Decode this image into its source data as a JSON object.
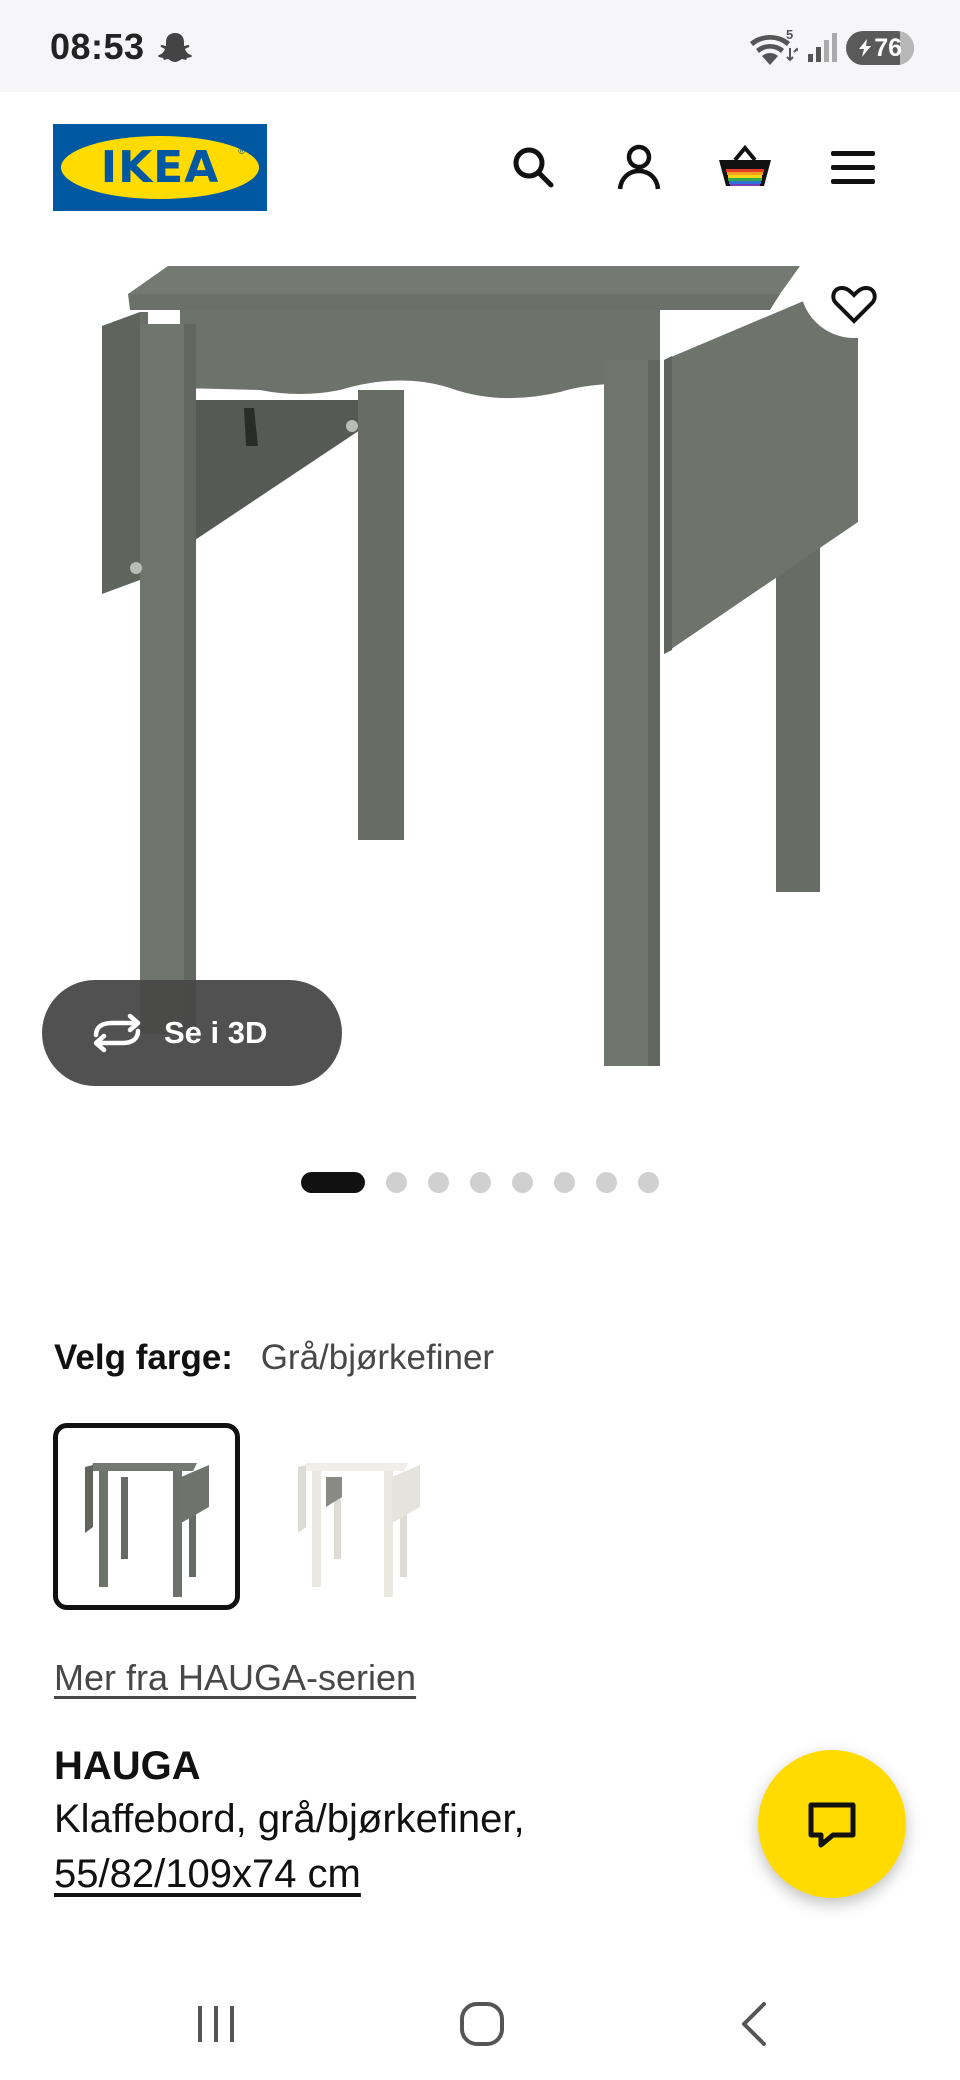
{
  "status_bar": {
    "time": "08:53",
    "battery": "76",
    "wifi_badge": "5",
    "icons": [
      "snapchat-icon",
      "wifi-icon",
      "signal-icon",
      "battery-icon"
    ]
  },
  "header": {
    "logo_text": "IKEA",
    "logo_colors": {
      "blue": "#0058a3",
      "yellow": "#ffdb00"
    },
    "actions": [
      "search-icon",
      "account-icon",
      "cart-icon",
      "menu-icon"
    ]
  },
  "gallery": {
    "view_3d_label": "Se i 3D",
    "image_count": 8,
    "active_index": 0,
    "favorite_icon": "heart-icon"
  },
  "color_picker": {
    "label": "Velg farge:",
    "selected_value": "Grå/bjørkefiner",
    "options": [
      {
        "name": "Grå/bjørkefiner",
        "color": "#6f756d",
        "selected": true
      },
      {
        "name": "Hvit",
        "color": "#ecebe4",
        "selected": false
      }
    ]
  },
  "series_link": "Mer fra HAUGA-serien",
  "product": {
    "name": "HAUGA",
    "description": "Klaffebord, grå/bjørkefiner,",
    "size": "55/82/109x74 cm"
  },
  "chat": {
    "icon": "chat-icon",
    "color": "#ffdb00"
  },
  "nav": [
    "recent-apps-icon",
    "home-icon",
    "back-icon"
  ]
}
